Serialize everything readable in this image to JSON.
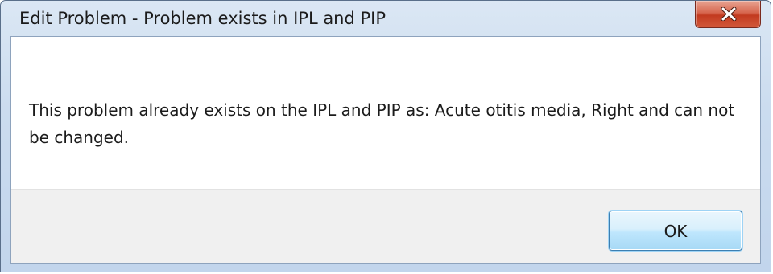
{
  "window": {
    "title": "Edit Problem - Problem exists in IPL and PIP",
    "close_icon": "close-icon"
  },
  "message": {
    "text": "This problem already exists on the IPL and PIP as: Acute otitis media, Right and can not be changed."
  },
  "buttons": {
    "ok_label": "OK"
  },
  "colors": {
    "close_button": "#c94a2f",
    "ok_button_border": "#3c7fb1",
    "footer_bg": "#f0f0f0",
    "titlebar_bg": "#cbdcef"
  }
}
